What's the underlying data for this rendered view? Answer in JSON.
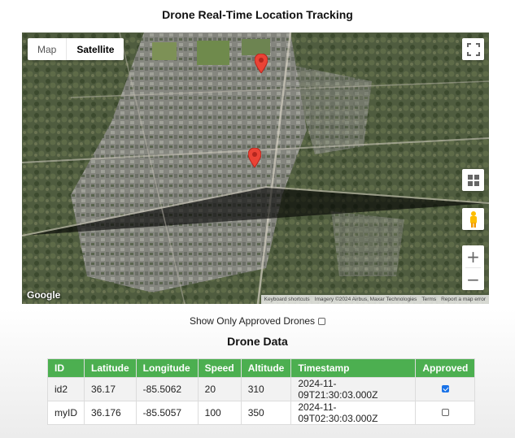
{
  "page_title": "Drone Real-Time Location Tracking",
  "map": {
    "type_buttons": {
      "map": "Map",
      "satellite": "Satellite"
    },
    "active_type": "Satellite",
    "logo": "Google",
    "attribution": {
      "shortcuts": "Keyboard shortcuts",
      "imagery": "Imagery ©2024 Airbus, Maxar Technologies",
      "terms": "Terms",
      "report": "Report a map error"
    },
    "zoom_in": "+",
    "zoom_out": "−",
    "markers": [
      "drone-marker-id2",
      "drone-marker-myID"
    ],
    "marker_color": "#ea4335"
  },
  "filter": {
    "label": "Show Only Approved Drones",
    "checked": false
  },
  "section_title": "Drone Data",
  "table": {
    "headers": [
      "ID",
      "Latitude",
      "Longitude",
      "Speed",
      "Altitude",
      "Timestamp",
      "Approved"
    ],
    "rows": [
      {
        "id": "id2",
        "latitude": "36.17",
        "longitude": "-85.5062",
        "speed": "20",
        "altitude": "310",
        "timestamp": "2024-11-09T21:30:03.000Z",
        "approved": true
      },
      {
        "id": "myID",
        "latitude": "36.176",
        "longitude": "-85.5057",
        "speed": "100",
        "altitude": "350",
        "timestamp": "2024-11-09T02:30:03.000Z",
        "approved": false
      }
    ],
    "header_color": "#4caf50"
  }
}
